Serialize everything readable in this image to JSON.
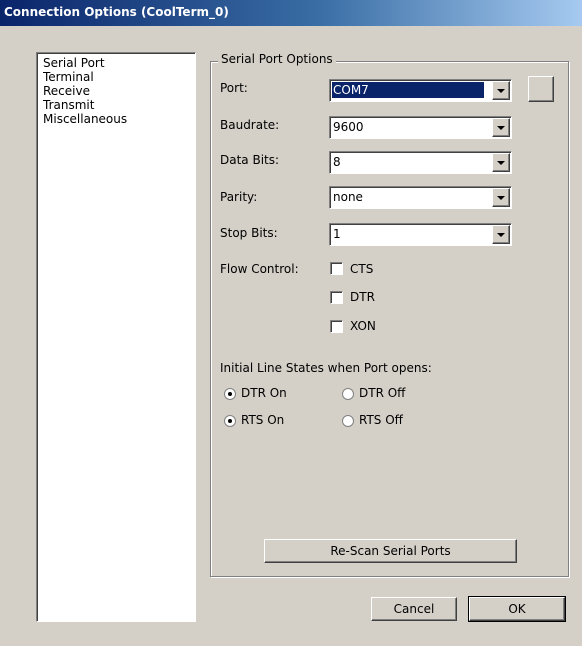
{
  "window": {
    "title": "Connection Options (CoolTerm_0)"
  },
  "sidebar": {
    "items": [
      {
        "label": "Serial Port",
        "selected": true
      },
      {
        "label": "Terminal"
      },
      {
        "label": "Receive"
      },
      {
        "label": "Transmit"
      },
      {
        "label": "Miscellaneous"
      }
    ]
  },
  "serial_port_options": {
    "group_title": "Serial Port Options",
    "port": {
      "label": "Port:",
      "value": "COM7"
    },
    "baudrate": {
      "label": "Baudrate:",
      "value": "9600"
    },
    "data_bits": {
      "label": "Data Bits:",
      "value": "8"
    },
    "parity": {
      "label": "Parity:",
      "value": "none"
    },
    "stop_bits": {
      "label": "Stop Bits:",
      "value": "1"
    },
    "flow_control": {
      "label": "Flow Control:",
      "options": [
        {
          "label": "CTS",
          "checked": false
        },
        {
          "label": "DTR",
          "checked": false
        },
        {
          "label": "XON",
          "checked": false
        }
      ]
    },
    "initial_states": {
      "label": "Initial Line States when Port opens:",
      "dtr_on": {
        "label": "DTR On",
        "checked": true
      },
      "dtr_off": {
        "label": "DTR Off",
        "checked": false
      },
      "rts_on": {
        "label": "RTS On",
        "checked": true
      },
      "rts_off": {
        "label": "RTS Off",
        "checked": false
      }
    },
    "rescan_label": "Re-Scan Serial Ports"
  },
  "footer": {
    "cancel_label": "Cancel",
    "ok_label": "OK"
  },
  "colors": {
    "title_bar": "#0a246a",
    "dialog_bg": "#d4d0c8",
    "selection": "#0a246a"
  }
}
